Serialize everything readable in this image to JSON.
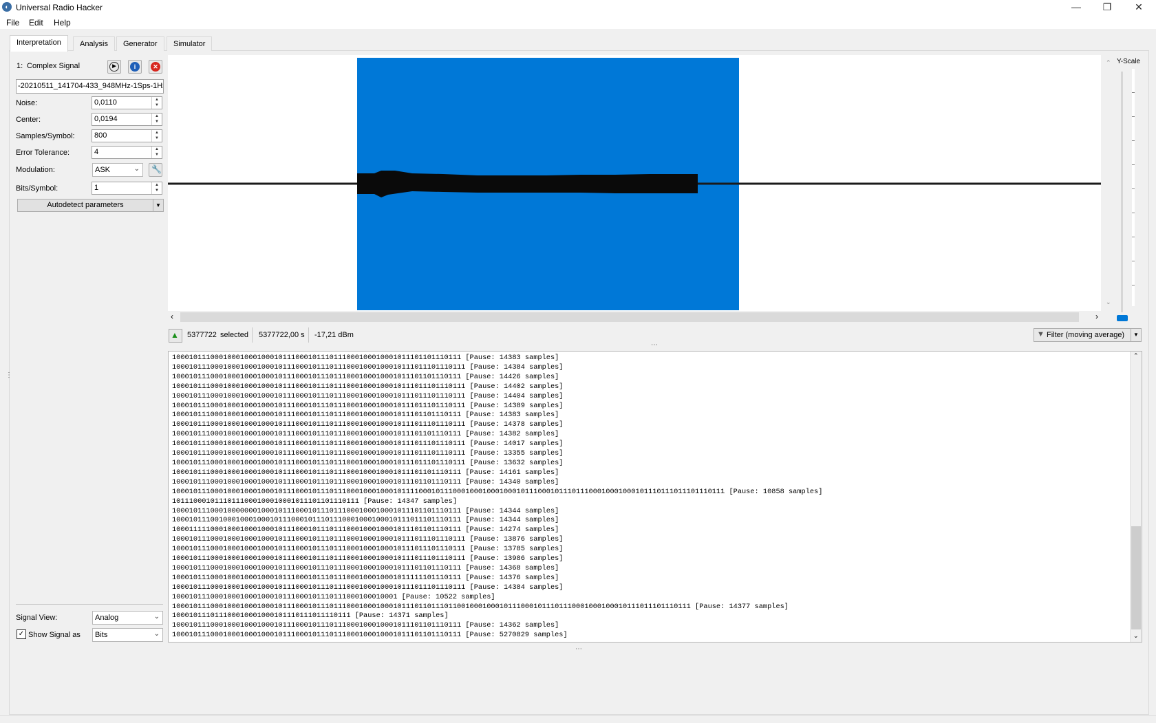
{
  "window": {
    "title": "Universal Radio Hacker"
  },
  "menu": [
    "File",
    "Edit",
    "Help"
  ],
  "tabs": [
    "Interpretation",
    "Analysis",
    "Generator",
    "Simulator"
  ],
  "signal": {
    "index_label": "1:",
    "name": "Complex Signal",
    "filename": "-20210511_141704-433_948MHz-1Sps-1Hz"
  },
  "params": {
    "noise_label": "Noise:",
    "noise": "0,0110",
    "center_label": "Center:",
    "center": "0,0194",
    "sps_label": "Samples/Symbol:",
    "sps": "800",
    "err_label": "Error Tolerance:",
    "err": "4",
    "mod_label": "Modulation:",
    "mod": "ASK",
    "bps_label": "Bits/Symbol:",
    "bps": "1",
    "autodetect": "Autodetect parameters"
  },
  "view": {
    "signal_view_label": "Signal View:",
    "signal_view": "Analog",
    "show_as_label": "Show Signal as",
    "show_as": "Bits",
    "show_as_checked": true
  },
  "yscale": {
    "label": "Y-Scale"
  },
  "status": {
    "selected_count": "5377722",
    "selected_word": "selected",
    "duration": "5377722,00 s",
    "power": "-17,21 dBm",
    "filter": "Filter (moving average)"
  },
  "bits_lines": [
    "10001011100010001000100010111000101110111000100010001011101101110111 [Pause: 14383 samples]",
    "100010111000100010001000101110001011101110001000100010111011101110111 [Pause: 14384 samples]",
    "10001011100010001000100010111000101110111000100010001011101101110111 [Pause: 14426 samples]",
    "100010111000100010001000101110001011101110001000100010111011101110111 [Pause: 14402 samples]",
    "100010111000100010001000101110001011101110001000100010111011101110111 [Pause: 14404 samples]",
    "100010111000100010001000101110001011101110001000100010111011101110111 [Pause: 14389 samples]",
    "10001011100010001000100010111000101110111000100010001011101101110111 [Pause: 14383 samples]",
    "100010111000100010001000101110001011101110001000100010111011101110111 [Pause: 14378 samples]",
    "10001011100010001000100010111000101110111000100010001011101101110111 [Pause: 14382 samples]",
    "100010111000100010001000101110001011101110001000100010111011101110111 [Pause: 14017 samples]",
    "100010111000100010001000101110001011101110001000100010111011101110111 [Pause: 13355 samples]",
    "100010111000100010001000101110001011101110001000100010111011101110111 [Pause: 13632 samples]",
    "10001011100010001000100010111000101110111000100010001011101101110111 [Pause: 14161 samples]",
    "10001011100010001000100010111000101110111000100010001011101101110111 [Pause: 14340 samples]",
    "1000101110001000100010001011100010111011100010001000101111000101110001000100010001011100010111011100010001000101110111011101110111 [Pause: 10858 samples]",
    "10111000101110111000100010001011101101110111 [Pause: 14347 samples]",
    "10001011100010000000100010111000101110111000100010001011101101110111 [Pause: 14344 samples]",
    "10001011100100010001000101110001011101110001000100010111011101110111 [Pause: 14344 samples]",
    "10001111100010001000100010111000101110111000100010001011101101110111 [Pause: 14274 samples]",
    "100010111000100010001000101110001011101110001000100010111011101110111 [Pause: 13876 samples]",
    "100010111000100010001000101110001011101110001000100010111011101110111 [Pause: 13785 samples]",
    "100010111000100010001000101110001011101110001000100010111011101110111 [Pause: 13986 samples]",
    "10001011100010001000100010111000101110111000100010001011101101110111 [Pause: 14368 samples]",
    "10001011100010001000100010111000101110111000100010001011111101110111 [Pause: 14376 samples]",
    "100010111000100010001000101110001011101110001000100010111011101110111 [Pause: 14384 samples]",
    "10001011100010001000100010111000101110111000100010001 [Pause: 10522 samples]",
    "10001011100010001000100010111000101110111000100010001011101101110110010001000101110001011101110001000100010111011101110111 [Pause: 14377 samples]",
    "100010111011100010001000101110111011110111 [Pause: 14371 samples]",
    "10001011100010001000100010111000101110111000100010001011101101110111 [Pause: 14362 samples]",
    "10001011100010001000100010111000101110111000100010001011101101110111 [Pause: 5270829 samples]"
  ]
}
